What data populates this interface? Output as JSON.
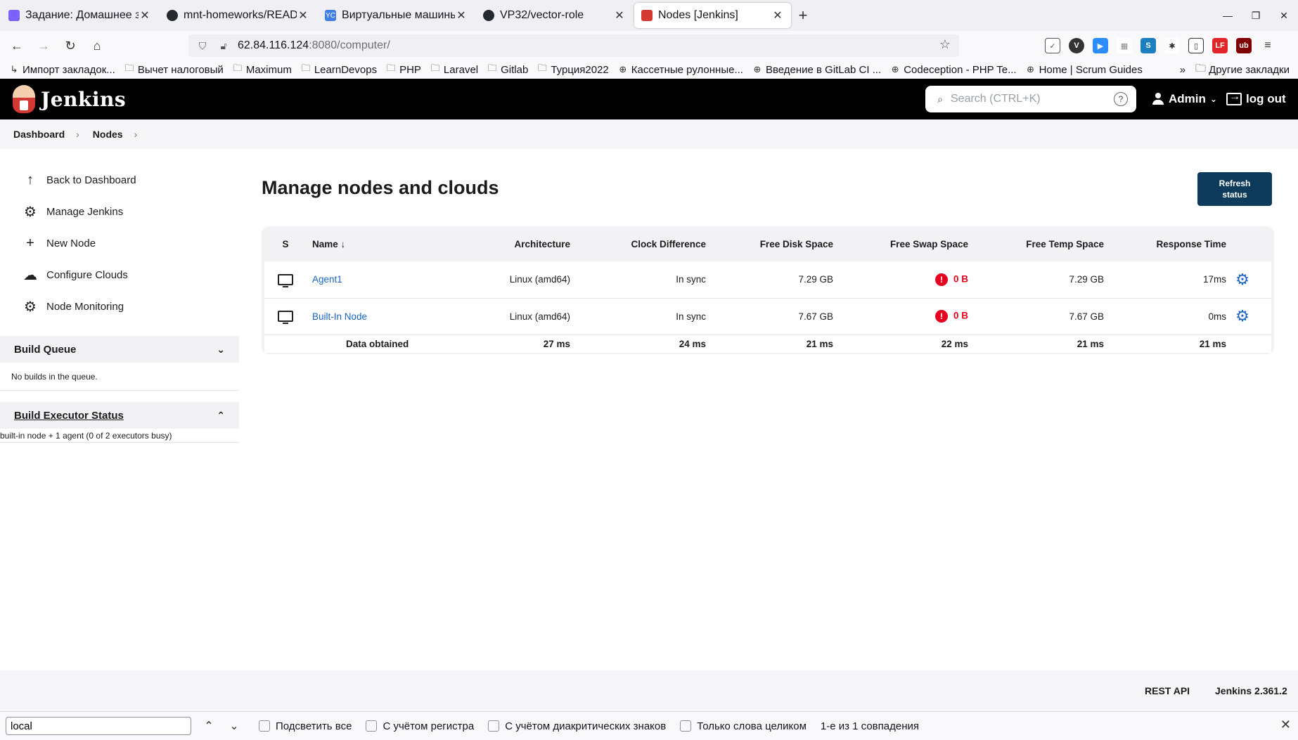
{
  "browser": {
    "tabs": [
      {
        "title": "Задание: Домашнее зад",
        "favicon_color": "#7b61ff",
        "active": false
      },
      {
        "title": "mnt-homeworks/READM",
        "favicon_color": "#24292f",
        "active": false
      },
      {
        "title": "Виртуальные машины |",
        "favicon_color": "#3f7fe6",
        "favicon_text": "YC",
        "active": false
      },
      {
        "title": "VP32/vector-role",
        "favicon_color": "#24292f",
        "active": false
      },
      {
        "title": "Nodes [Jenkins]",
        "favicon_color": "#d33833",
        "active": true
      }
    ],
    "url_host": "62.84.116.124",
    "url_rest": ":8080/computer/",
    "bookmarks": [
      {
        "label": "Импорт закладок...",
        "icon": "import-icon"
      },
      {
        "label": "Вычет налоговый",
        "icon": "folder-icon"
      },
      {
        "label": "Maximum",
        "icon": "folder-icon"
      },
      {
        "label": "LearnDevops",
        "icon": "folder-icon"
      },
      {
        "label": "PHP",
        "icon": "folder-icon"
      },
      {
        "label": "Laravel",
        "icon": "folder-icon"
      },
      {
        "label": "Gitlab",
        "icon": "folder-icon"
      },
      {
        "label": "Турция2022",
        "icon": "folder-icon"
      },
      {
        "label": "Кассетные рулонные...",
        "icon": "globe-icon"
      },
      {
        "label": "Введение в GitLab CI ...",
        "icon": "globe-icon"
      },
      {
        "label": "Codeception - PHP Te...",
        "icon": "globe-icon"
      },
      {
        "label": "Home | Scrum Guides",
        "icon": "globe-icon"
      }
    ],
    "other_bookmarks": "Другие закладки"
  },
  "jenkins": {
    "brand": "Jenkins",
    "search_placeholder": "Search (CTRL+K)",
    "user": "Admin",
    "logout": "log out"
  },
  "breadcrumb": [
    "Dashboard",
    "Nodes"
  ],
  "sidebar": {
    "items": [
      {
        "label": "Back to Dashboard",
        "icon": "arrow-up-icon"
      },
      {
        "label": "Manage Jenkins",
        "icon": "gear-icon"
      },
      {
        "label": "New Node",
        "icon": "plus-icon"
      },
      {
        "label": "Configure Clouds",
        "icon": "cloud-icon"
      },
      {
        "label": "Node Monitoring",
        "icon": "gear-icon"
      }
    ],
    "build_queue": {
      "title": "Build Queue",
      "body": "No builds in the queue."
    },
    "executor_status": {
      "title": "Build Executor Status",
      "body": "built-in node + 1 agent (0 of 2 executors busy)"
    }
  },
  "main": {
    "title": "Manage nodes and clouds",
    "refresh_button": "Refresh\nstatus",
    "table": {
      "headers": {
        "s": "S",
        "name": "Name",
        "sort_indicator": "↓",
        "arch": "Architecture",
        "clock": "Clock Difference",
        "disk": "Free Disk Space",
        "swap": "Free Swap Space",
        "temp": "Free Temp Space",
        "resp": "Response Time"
      },
      "rows": [
        {
          "name": "Agent1",
          "arch": "Linux (amd64)",
          "clock": "In sync",
          "disk": "7.29 GB",
          "swap": "0 B",
          "temp": "7.29 GB",
          "resp": "17ms"
        },
        {
          "name": "Built-In Node",
          "arch": "Linux (amd64)",
          "clock": "In sync",
          "disk": "7.67 GB",
          "swap": "0 B",
          "temp": "7.67 GB",
          "resp": "0ms"
        }
      ],
      "footer": {
        "label": "Data obtained",
        "arch": "27 ms",
        "clock": "24 ms",
        "disk": "21 ms",
        "swap": "22 ms",
        "temp": "21 ms",
        "resp": "21 ms"
      }
    }
  },
  "footer": {
    "rest_api": "REST API",
    "version": "Jenkins 2.361.2"
  },
  "findbar": {
    "query": "local",
    "highlight_all": "Подсветить все",
    "match_case": "С учётом регистра",
    "match_diacritics": "С учётом диакритических знаков",
    "whole_words": "Только слова целиком",
    "result": "1-е из 1 совпадения"
  }
}
